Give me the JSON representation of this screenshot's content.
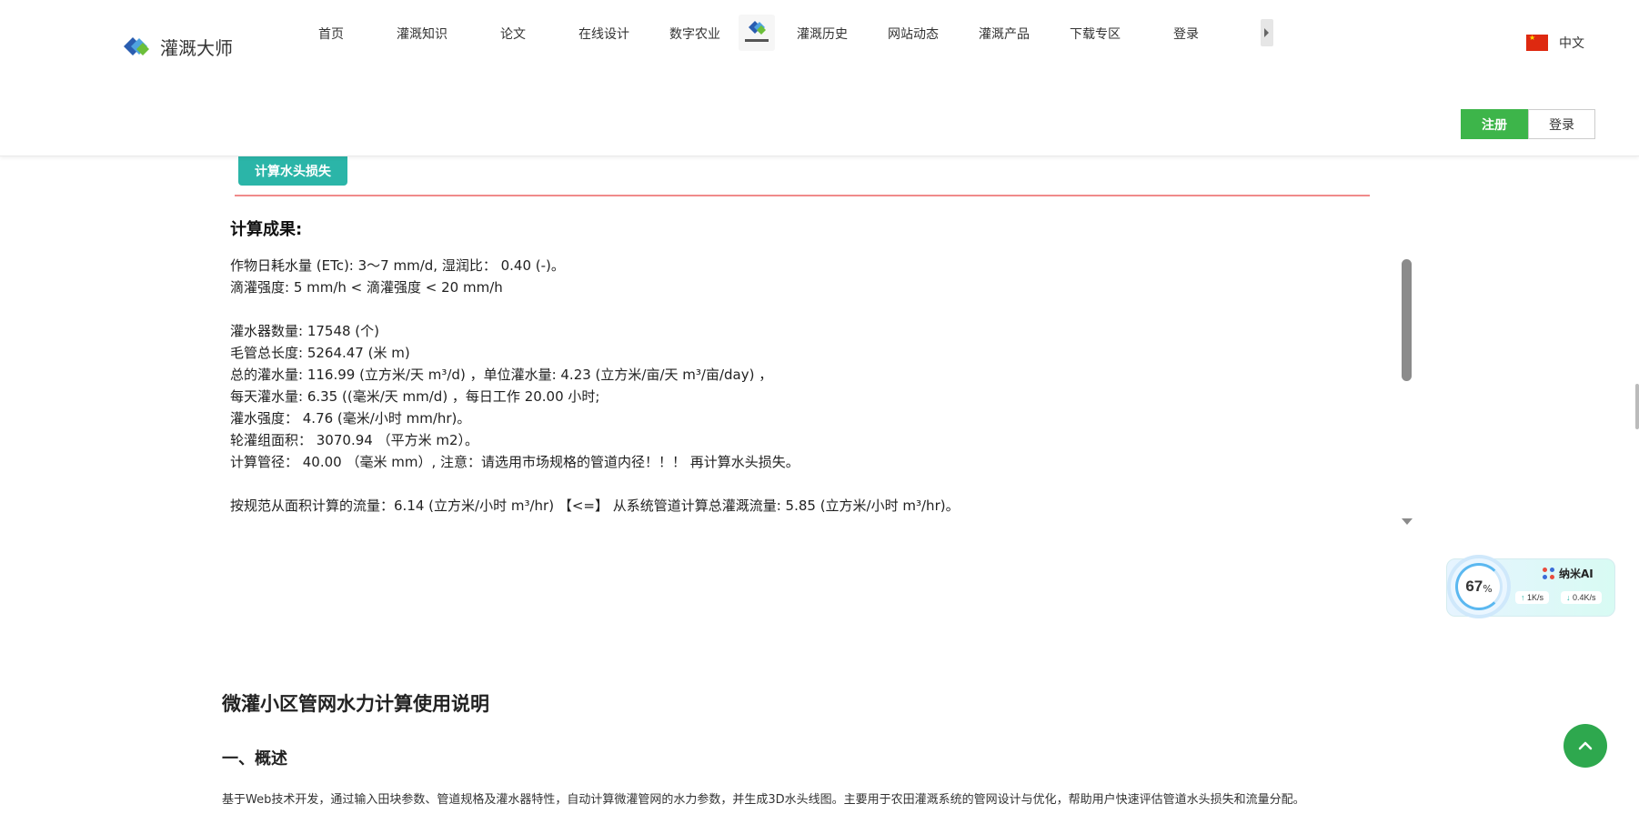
{
  "header": {
    "logo_text": "灌溉大师",
    "nav": [
      {
        "label": "首页"
      },
      {
        "label": "灌溉知识"
      },
      {
        "label": "论文"
      },
      {
        "label": "在线设计"
      },
      {
        "label": "数字农业"
      },
      {
        "label": "灌溉历史"
      },
      {
        "label": "网站动态"
      },
      {
        "label": "灌溉产品"
      },
      {
        "label": "下载专区"
      },
      {
        "label": "登录"
      }
    ],
    "language": "中文",
    "register_label": "注册",
    "login_label": "登录"
  },
  "result": {
    "calc_button": "计算水头损失",
    "title": "计算成果:",
    "lines": [
      "作物日耗水量 (ETc): 3～7 mm/d, 湿润比：  0.40 (-)。",
      "滴灌强度: 5 mm/h < 滴灌强度 < 20 mm/h",
      "",
      "灌水器数量: 17548 (个)",
      "毛管总长度: 5264.47 (米 m)",
      "总的灌水量: 116.99 (立方米/天 m³/d) ，单位灌水量: 4.23 (立方米/亩/天 m³/亩/day) ，",
      "每天灌水量: 6.35 ((毫米/天 mm/d) ，每日工作 20.00 小时;",
      "灌水强度：  4.76 (毫米/小时 mm/hr)。",
      "轮灌组面积：  3070.94  （平方米 m2）。",
      "计算管径：  40.00  （毫米 mm）, 注意：请选用市场规格的管道内径！！！ 再计算水头损失。",
      "",
      "按规范从面积计算的流量：6.14 (立方米/小时 m³/hr) 【<=】 从系统管道计算总灌溉流量: 5.85 (立方米/小时 m³/hr)。"
    ]
  },
  "instructions": {
    "title": "微灌小区管网水力计算使用说明",
    "section1": "一、概述",
    "overview": "基于Web技术开发，通过输入田块参数、管道规格及灌水器特性，自动计算微灌管网的水力参数，并生成3D水头线图。主要用于农田灌溉系统的管网设计与优化，帮助用户快速评估管道水头损失和流量分配。"
  },
  "widget": {
    "percent": "67",
    "percent_sign": "%",
    "ai_label": "纳米AI",
    "upload": "1K/s",
    "download": "0.4K/s"
  },
  "colors": {
    "green": "#3db54a",
    "teal": "#2bb5a8",
    "red_line": "#f08a8a",
    "top_button": "#2ea84e"
  },
  "icons": {
    "logo": "diamond-logo-icon",
    "flag": "china-flag-icon",
    "back_to_top": "chevron-up-icon"
  }
}
